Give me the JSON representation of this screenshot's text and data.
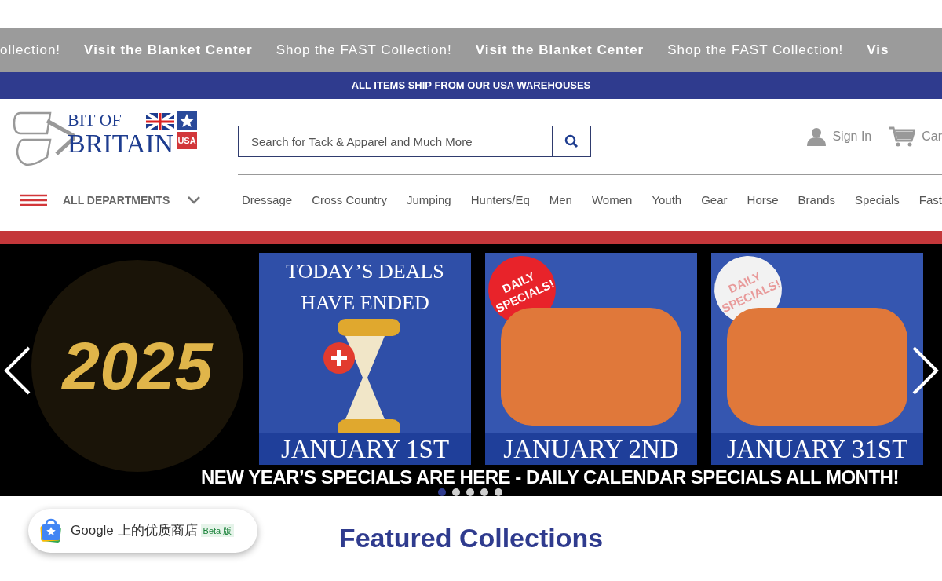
{
  "marquee": [
    {
      "text": "ollection!",
      "emphasis": false
    },
    {
      "text": "Visit the Blanket Center",
      "emphasis": true
    },
    {
      "text": "Shop the FAST Collection!",
      "emphasis": false
    },
    {
      "text": "Visit the Blanket Center",
      "emphasis": true
    },
    {
      "text": "Shop the FAST Collection!",
      "emphasis": false
    },
    {
      "text": "Vis",
      "emphasis": true
    }
  ],
  "shipping_bar": "ALL ITEMS SHIP FROM OUR USA WAREHOUSES",
  "logo": {
    "line1": "BIT OF",
    "line2": "BRITAIN",
    "badge": "USA"
  },
  "search": {
    "placeholder": "Search for Tack & Apparel and Much More"
  },
  "account": {
    "sign_in": "Sign In",
    "cart": "Car"
  },
  "departments": "ALL DEPARTMENTS",
  "nav": [
    "Dressage",
    "Cross Country",
    "Jumping",
    "Hunters/Eq",
    "Men",
    "Women",
    "Youth",
    "Gear",
    "Horse",
    "Brands",
    "Specials",
    "Fast"
  ],
  "hero": {
    "art_text": "2025",
    "tiles": [
      {
        "kind": "ended",
        "heading": "TODAY’S DEALS HAVE ENDED",
        "date": "JANUARY 1ST"
      },
      {
        "kind": "specials",
        "badge": "DAILY SPECIALS!",
        "color": "#e8232a",
        "date": "JANUARY 2ND"
      },
      {
        "kind": "specials",
        "badge": "DAILY SPECIALS!",
        "color": "#f2f2f2",
        "date": "JANUARY 31ST"
      }
    ],
    "headline": "NEW YEAR’S SPECIALS ARE HERE - DAILY CALENDAR SPECIALS ALL MONTH!",
    "dots": [
      {
        "selected": true
      },
      {
        "selected": false
      },
      {
        "selected": false
      },
      {
        "selected": false
      },
      {
        "selected": false
      }
    ]
  },
  "store_badge": {
    "label": "Google 上的优质商店",
    "tag": "Beta 版"
  },
  "section_title": "Featured Collections"
}
